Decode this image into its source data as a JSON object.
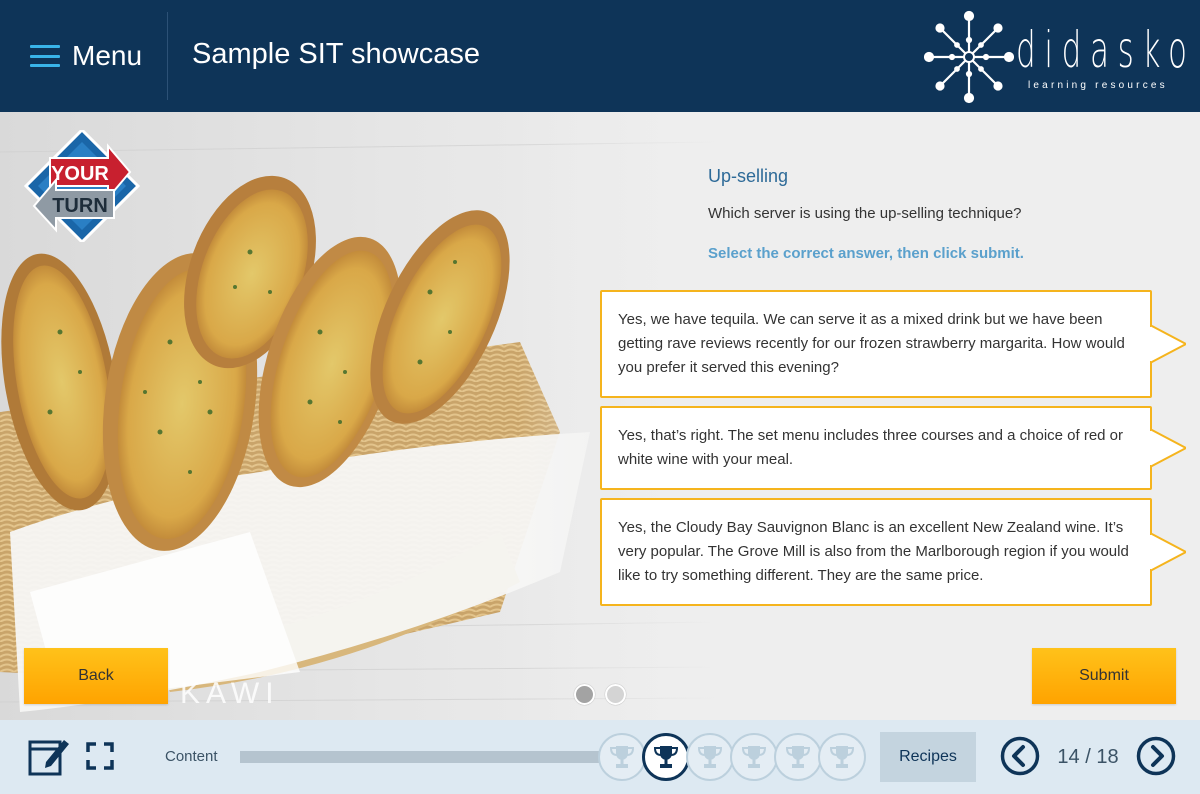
{
  "header": {
    "menu_label": "Menu",
    "course_title": "Sample SIT showcase",
    "logo": {
      "name": "didasko",
      "tagline": "learning resources"
    }
  },
  "badge": {
    "line1": "YOUR",
    "line2": "TURN"
  },
  "watermark": "KAWI",
  "question": {
    "title": "Up-selling",
    "prompt": "Which server is using the up-selling technique?",
    "instruction": "Select the correct answer, then click submit.",
    "options": [
      {
        "text": "Yes, we have tequila. We can serve it as a mixed drink but we have been getting rave reviews recently for our frozen strawberry margarita. How would you prefer it served this evening?"
      },
      {
        "text": "Yes, that’s right. The set menu includes three courses and a choice of red or white wine with your meal."
      },
      {
        "text": "Yes, the Cloudy Bay Sauvignon Blanc is an excellent New Zealand wine. It’s very popular. The Grove Mill is also from the Marlborough region if you would like to try something different. They are the same price."
      }
    ]
  },
  "buttons": {
    "back": "Back",
    "submit": "Submit"
  },
  "slide_dots": {
    "count": 2,
    "active_index": 0
  },
  "footer": {
    "content_label": "Content",
    "progress": 0.58,
    "trophies": {
      "count": 6,
      "active_index": 1
    },
    "recipes_label": "Recipes",
    "page_counter": "14 / 18"
  },
  "colors": {
    "header_bg": "#0e3458",
    "accent_blue": "#39b4e9",
    "option_border": "#f5b41d",
    "button_orange": "#ffb000",
    "footer_bg": "#dde9f2"
  },
  "icons": [
    "hamburger-icon",
    "didasko-star-logo",
    "your-turn-badge",
    "notes-edit-icon",
    "fullscreen-icon",
    "trophy-icon",
    "chevron-left-icon",
    "chevron-right-icon"
  ]
}
